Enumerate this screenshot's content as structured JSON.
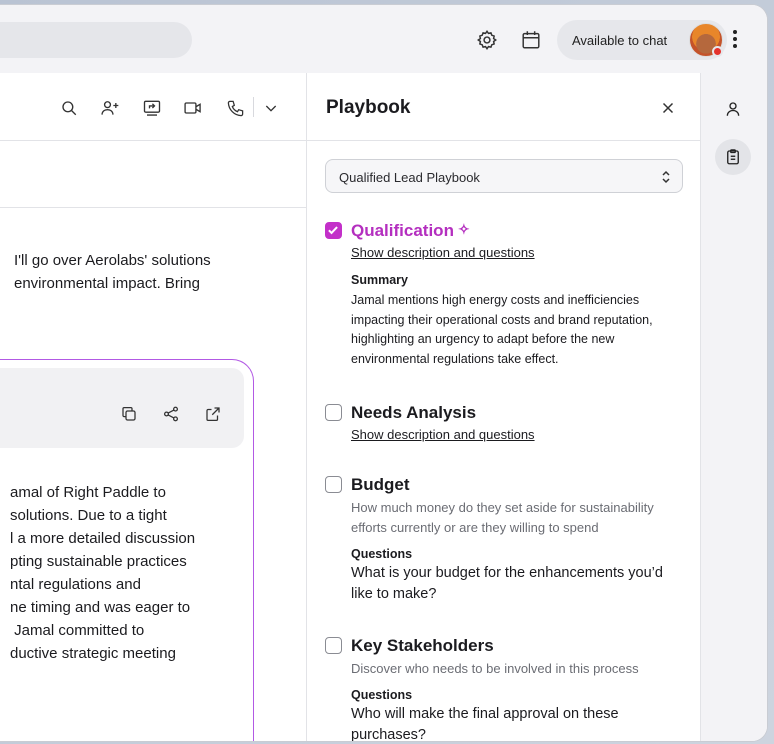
{
  "topbar": {
    "status_label": "Available to chat",
    "icons": [
      "settings-icon",
      "calendar-icon",
      "more-vertical-icon"
    ],
    "presence_color": "#e5322d"
  },
  "conversation": {
    "toolbar_icons": [
      "search-icon",
      "add-person-icon",
      "screen-share-icon",
      "video-icon",
      "phone-icon",
      "chevron-down-icon"
    ],
    "message_text": "I'll go over Aerolabs' solutions\nenvironmental impact. Bring",
    "card_icons": [
      "copy-icon",
      "share-icon",
      "external-link-icon"
    ],
    "card_text": "amal of Right Paddle to\nsolutions. Due to a tight\nl a more detailed discussion\npting sustainable practices\nntal regulations and\nne timing and was eager to\n Jamal committed to\nductive strategic meeting",
    "card_border_color": "#b259e4"
  },
  "playbook": {
    "title": "Playbook",
    "selected_playbook": "Qualified Lead Playbook",
    "accent_color": "#c330c9",
    "sections": [
      {
        "title": "Qualification",
        "checked": true,
        "link": "Show description and questions",
        "summary_label": "Summary",
        "summary": "Jamal mentions high energy costs and inefficiencies impacting their operational costs and brand reputation, highlighting an urgency to adapt before the new environmental regulations take effect."
      },
      {
        "title": "Needs Analysis",
        "checked": false,
        "link": "Show description and questions"
      },
      {
        "title": "Budget",
        "checked": false,
        "description": "How much money do they set aside for sustainability efforts currently or are they willing to spend",
        "questions_label": "Questions",
        "question": "What is your budget for the enhancements you’d like to make?"
      },
      {
        "title": "Key Stakeholders",
        "checked": false,
        "description": "Discover who needs to be involved in this process",
        "questions_label": "Questions",
        "question": "Who will make the final approval on these purchases?"
      }
    ]
  },
  "rail": {
    "icons": [
      "person-icon",
      "clipboard-icon"
    ],
    "active": "clipboard-icon"
  }
}
